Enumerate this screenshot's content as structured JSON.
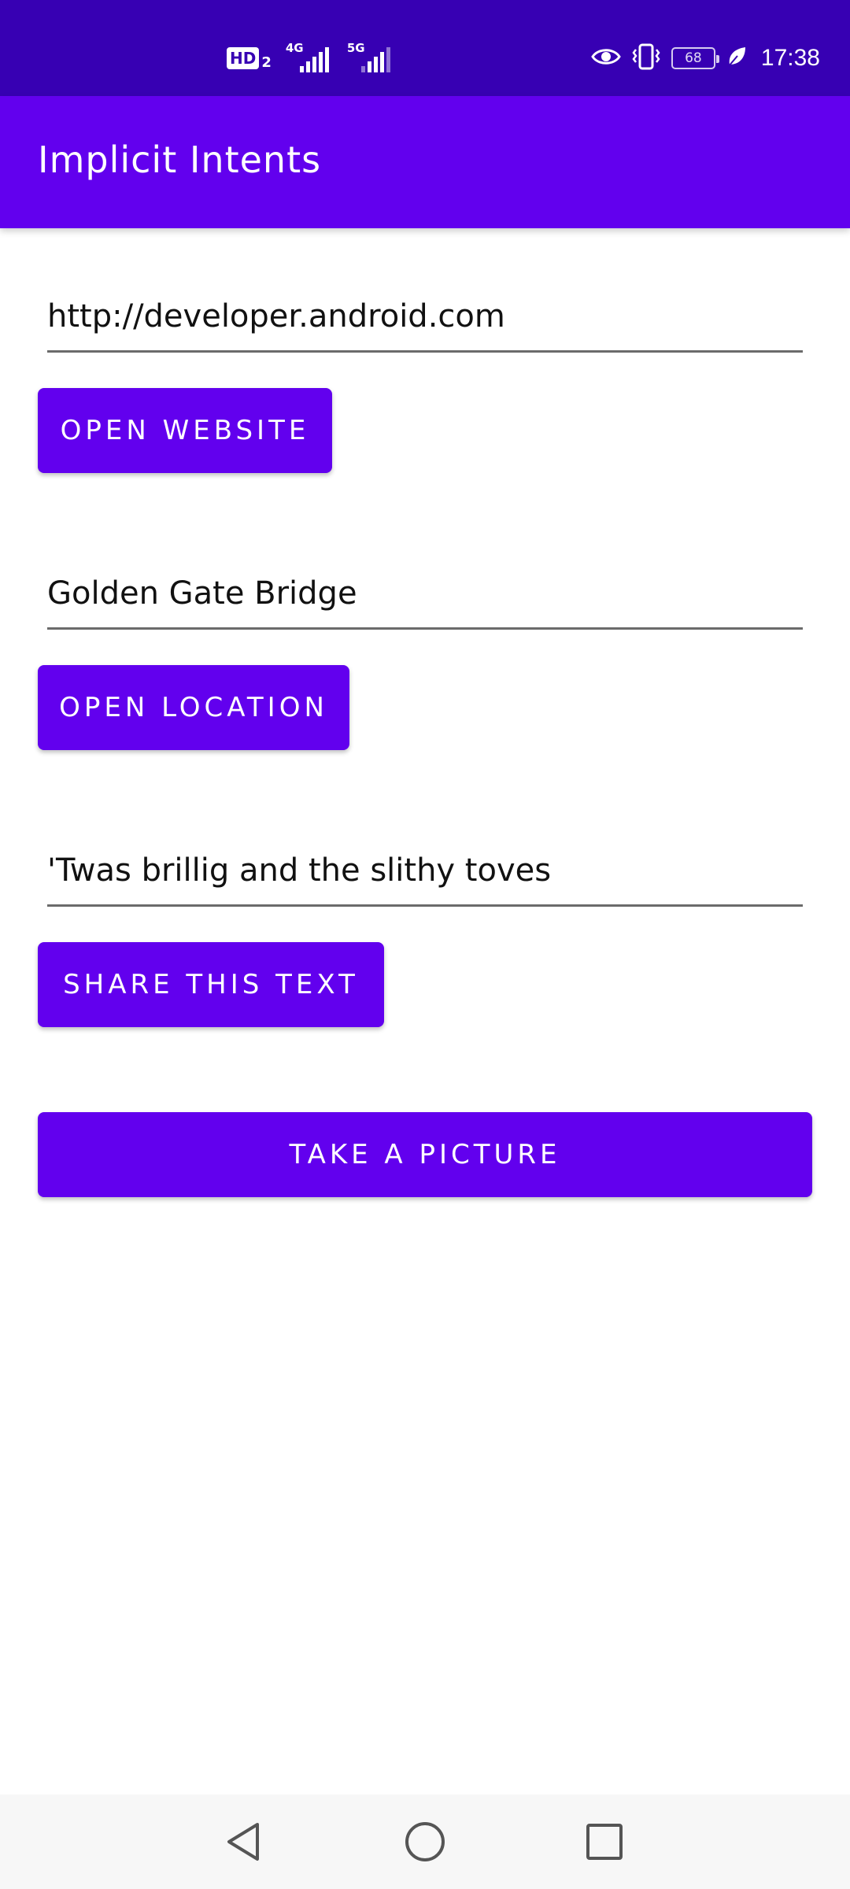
{
  "status_bar": {
    "hd_label": "HD",
    "sim_label": "2",
    "network_1": "4G",
    "network_2": "5G",
    "battery_level": "68",
    "time": "17:38",
    "icons": [
      "hd-icon",
      "signal-4g-icon",
      "signal-5g-icon",
      "eye-comfort-icon",
      "vibrate-icon",
      "battery-icon",
      "power-saving-leaf-icon"
    ]
  },
  "app_bar": {
    "title": "Implicit Intents"
  },
  "main": {
    "website_field": {
      "value": "http://developer.android.com"
    },
    "website_button": {
      "label": "Open Website"
    },
    "location_field": {
      "value": "Golden Gate Bridge"
    },
    "location_button": {
      "label": "Open Location"
    },
    "share_field": {
      "value": "'Twas brillig and the slithy toves"
    },
    "share_button": {
      "label": "Share This Text"
    },
    "picture_button": {
      "label": "Take a Picture"
    }
  },
  "nav_bar": {
    "icons": [
      "back-icon",
      "home-icon",
      "recents-icon"
    ]
  },
  "colors": {
    "status_bar": "#3700b3",
    "primary": "#6200ee",
    "underline": "#6b6b6b",
    "nav_bar": "#f7f7f7"
  }
}
